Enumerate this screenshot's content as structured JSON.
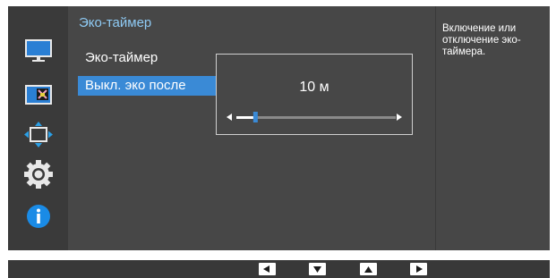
{
  "sidebar": {
    "icons": [
      "monitor-picture-icon",
      "color-icon",
      "size-position-icon",
      "settings-gear-icon",
      "information-icon"
    ]
  },
  "menu": {
    "title": "Эко-таймер",
    "items": [
      {
        "label": "Эко-таймер",
        "selected": false
      },
      {
        "label": "Выкл. эко после",
        "selected": true
      }
    ]
  },
  "submenu": {
    "value": "10 м",
    "slider_level": 0.12
  },
  "help": {
    "text": "Включение или отключение эко-таймера."
  },
  "footer": {
    "buttons": [
      "left-arrow-icon",
      "down-arrow-icon",
      "up-arrow-icon",
      "right-arrow-icon"
    ]
  },
  "colors": {
    "accent": "#3a8ad6",
    "title": "#8fcbf5",
    "panel": "#474747",
    "sidebar": "#3a3a3a",
    "info_icon": "#1a8be6"
  }
}
